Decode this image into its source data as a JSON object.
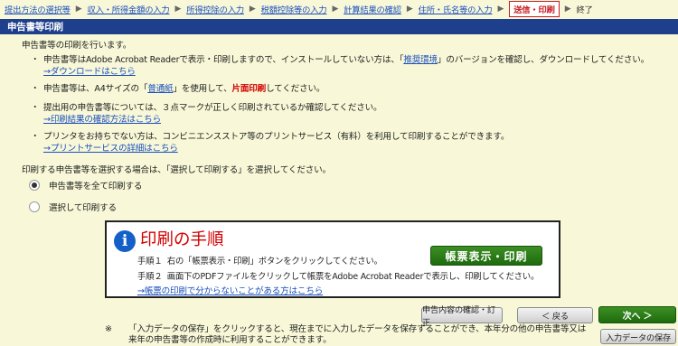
{
  "breadcrumb": {
    "items": [
      "提出方法の選択等",
      "収入・所得金額の入力",
      "所得控除の入力",
      "税額控除等の入力",
      "計算結果の確認",
      "住所・氏名等の入力"
    ],
    "separator": "▶",
    "current": "送信・印刷",
    "end": "終了"
  },
  "page_title": "申告書等印刷",
  "intro": "申告書等の印刷を行います。",
  "bullets": [
    {
      "text": "申告書等はAdobe Acrobat Readerで表示・印刷しますので、インストールしていない方は、「",
      "link": "推奨環境",
      "text2": "」のバージョンを確認し、ダウンロードしてください。",
      "sublink": "→ダウンロードはこちら"
    },
    {
      "text": "申告書等は、A4サイズの「",
      "link": "普通紙",
      "text2": "」を使用して、",
      "red": "片面印刷",
      "text3": "してください。"
    },
    {
      "text": "提出用の申告書等については、３点マークが正しく印刷されているか確認してください。",
      "sublink": "→印刷結果の確認方法はこちら"
    },
    {
      "text": "プリンタをお持ちでない方は、コンビニエンスストア等のプリントサービス（有料）を利用して印刷することができます。",
      "sublink": "→プリントサービスの詳細はこちら"
    }
  ],
  "select_note": "印刷する申告書等を選択する場合は、「選択して印刷する」を選択してください。",
  "radios": [
    {
      "label": "申告書等を全て印刷する",
      "checked": true
    },
    {
      "label": "選択して印刷する",
      "checked": false
    }
  ],
  "procedure": {
    "title": "印刷の手順",
    "icon": "info-icon",
    "step1_label": "手順１",
    "step1_text": "右の「帳票表示・印刷」ボタンをクリックしてください。",
    "step2_label": "手順２",
    "step2_text": "画面下のPDFファイルをクリックして帳票をAdobe Acrobat Readerで表示し、印刷してください。",
    "help_link": "→帳票の印刷で分からないことがある方はこちら",
    "print_button": "帳票表示・印刷"
  },
  "nav": {
    "confirm_button": "申告内容の確認・訂正",
    "back_button": "＜ 戻る",
    "next_button": "次へ ＞",
    "save_button": "入力データの保存"
  },
  "footnote": {
    "mark": "※",
    "text": "「入力データの保存」をクリックすると、現在までに入力したデータを保存することができ、本年分の他の申告書等又は来年の申告書等の作成時に利用することができます。"
  },
  "colors": {
    "background": "#f8f8d8",
    "title_bar": "#1d3f8c",
    "accent_red": "#c81d25",
    "green_button": "#2a7d18",
    "link": "#1a4fbf",
    "info_icon": "#1560c8"
  }
}
